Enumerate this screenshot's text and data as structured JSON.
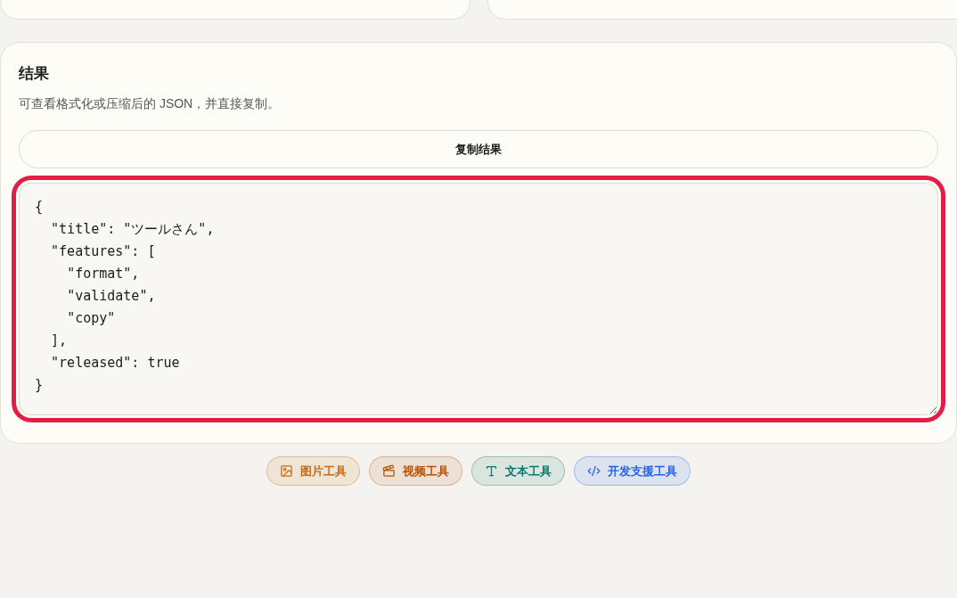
{
  "result": {
    "title": "结果",
    "description": "可查看格式化或压缩后的 JSON，并直接复制。",
    "copy_button": "复制结果",
    "output": {
      "value": "{\n  \"title\": \"ツールさん\",\n  \"features\": [\n    \"format\",\n    \"validate\",\n    \"copy\"\n  ],\n  \"released\": true\n}",
      "focused": true
    }
  },
  "tool_links": [
    {
      "label": "图片工具",
      "kind": "image",
      "color": "#c96a12"
    },
    {
      "label": "视频工具",
      "kind": "video",
      "color": "#b45309"
    },
    {
      "label": "文本工具",
      "kind": "text",
      "color": "#0f766e"
    },
    {
      "label": "开发支援工具",
      "kind": "code",
      "color": "#2563eb"
    }
  ]
}
